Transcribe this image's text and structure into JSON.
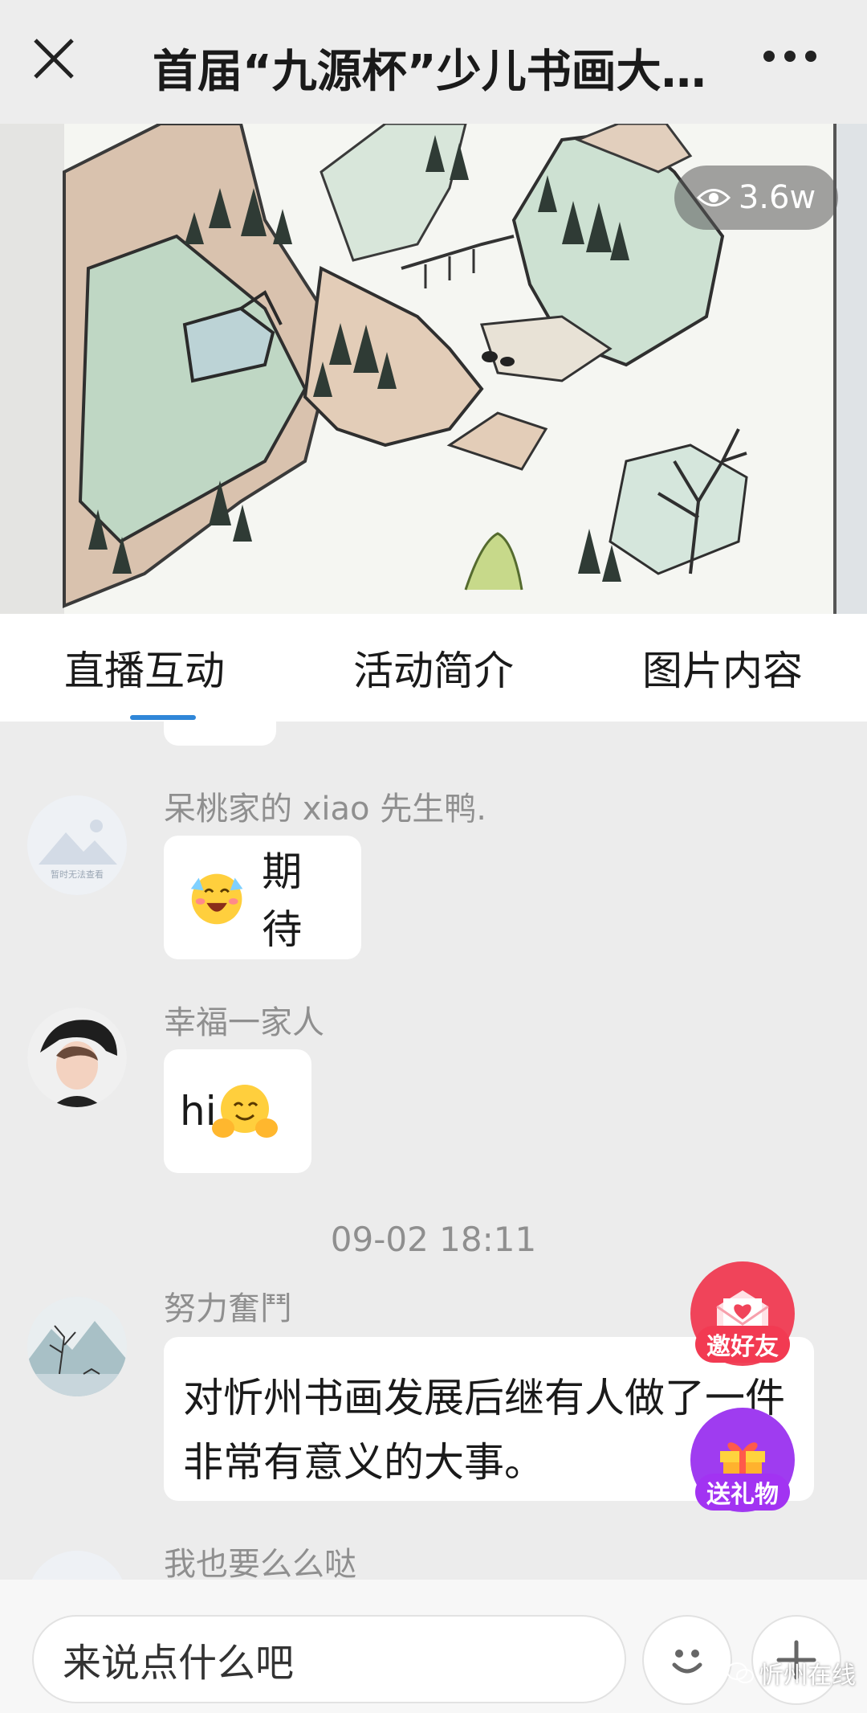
{
  "header": {
    "title": "首届“九源杯”少儿书画大…",
    "close_icon": "close-icon",
    "more_icon": "more-dots-icon"
  },
  "video": {
    "viewer_count": "3.6w",
    "viewer_icon": "eye-icon"
  },
  "tabs": [
    {
      "label": "直播互动",
      "active": true
    },
    {
      "label": "活动简介",
      "active": false
    },
    {
      "label": "图片内容",
      "active": false
    }
  ],
  "accent_color": "#2f86d8",
  "messages": [
    {
      "user": "呆桃家的 xiao 先生鸭.",
      "avatar_caption": "暂时无法查看",
      "text": "期待",
      "emoji": "excited-face-emoji"
    },
    {
      "user": "幸福一家人",
      "text": "hi",
      "emoji": "hugging-face-emoji"
    },
    {
      "user": "努力奮鬥",
      "text": "对忻州书画发展后继有人做了一件非常有意义的大事。"
    },
    {
      "user": "我也要么么哒"
    }
  ],
  "timestamp": "09-02 18:11",
  "floating_actions": {
    "invite_label": "邀好友",
    "gift_label": "送礼物"
  },
  "composer": {
    "placeholder": "来说点什么吧",
    "emoji_icon": "smiley-icon",
    "plus_icon": "plus-icon"
  },
  "watermark": "忻州在线"
}
